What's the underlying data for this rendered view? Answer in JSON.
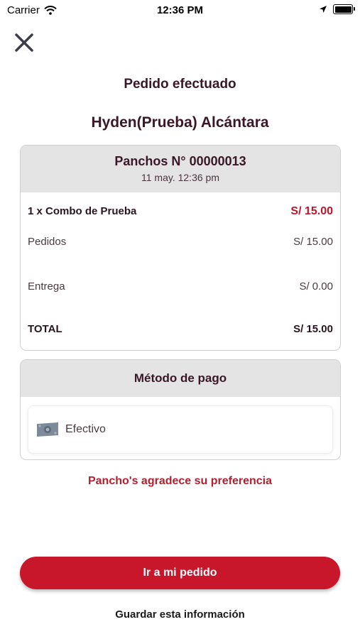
{
  "status_bar": {
    "carrier": "Carrier",
    "time": "12:36 PM"
  },
  "header": {
    "title": "Pedido efectuado",
    "customer_name": "Hyden(Prueba) Alcántara"
  },
  "order": {
    "number": "Panchos N° 00000013",
    "date": "11 may. 12:36 pm",
    "item": {
      "label": "1 x Combo de Prueba",
      "price": "S/ 15.00"
    },
    "subtotal": {
      "label": "Pedidos",
      "value": "S/ 15.00"
    },
    "delivery": {
      "label": "Entrega",
      "value": "S/ 0.00"
    },
    "total": {
      "label": "TOTAL",
      "value": "S/ 15.00"
    }
  },
  "payment": {
    "title": "Método de pago",
    "method": "Efectivo",
    "method_icon": "cash-icon"
  },
  "thanks_message": "Pancho's agradece su preferencia",
  "actions": {
    "primary": "Ir a mi pedido",
    "secondary": "Guardar esta información"
  },
  "colors": {
    "accent": "#c8172a",
    "text_dark": "#3a1727",
    "card_header": "#e4e4e4"
  }
}
